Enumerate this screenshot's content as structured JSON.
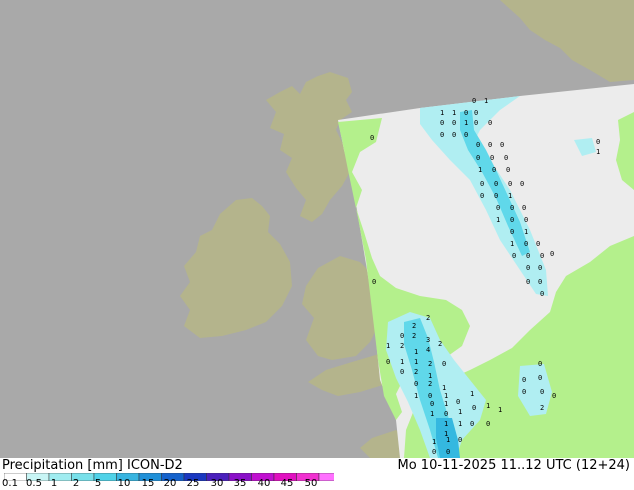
{
  "header": {
    "title": "Precipitation [mm]  ICON-D2",
    "valid": "Mo 10-11-2025 11..12 UTC (12+24)"
  },
  "legend": {
    "ticks": [
      "0.1",
      "0.5",
      "1",
      "2",
      "5",
      "10",
      "15",
      "20",
      "25",
      "30",
      "35",
      "40",
      "45",
      "50"
    ],
    "colors": [
      "#ffffff",
      "#c8f5f5",
      "#a0ecf0",
      "#78e0ea",
      "#50d2e8",
      "#38b4e0",
      "#2090d8",
      "#1462cc",
      "#1a38c0",
      "#4a20bc",
      "#8a10c8",
      "#c010d0",
      "#e010c0",
      "#f030d0",
      "#ff70ff"
    ]
  },
  "map": {
    "colors": {
      "sea_outside": "#a9a9a9",
      "land_outside": "#b4b48c",
      "domain_sea": "#ececec",
      "domain_land": "#b4f08c",
      "precip_light": "#b0eef2",
      "precip_mid": "#60d8ea",
      "precip_heavy": "#34b8e0"
    },
    "values": [
      {
        "v": "0"
      },
      {
        "v": "1"
      },
      {
        "v": "1"
      },
      {
        "v": "1"
      },
      {
        "v": "0"
      },
      {
        "v": "0"
      },
      {
        "v": "0"
      },
      {
        "v": "0"
      },
      {
        "v": "1"
      },
      {
        "v": "0"
      },
      {
        "v": "0"
      },
      {
        "v": "0"
      },
      {
        "v": "0"
      },
      {
        "v": "0"
      },
      {
        "v": "0"
      },
      {
        "v": "0"
      },
      {
        "v": "0"
      },
      {
        "v": "0"
      },
      {
        "v": "0"
      },
      {
        "v": "0"
      },
      {
        "v": "1"
      },
      {
        "v": "0"
      },
      {
        "v": "0"
      },
      {
        "v": "0"
      },
      {
        "v": "0"
      },
      {
        "v": "0"
      },
      {
        "v": "0"
      },
      {
        "v": "0"
      },
      {
        "v": "0"
      },
      {
        "v": "1"
      },
      {
        "v": "0"
      },
      {
        "v": "0"
      },
      {
        "v": "0"
      },
      {
        "v": "1"
      },
      {
        "v": "0"
      },
      {
        "v": "0"
      },
      {
        "v": "0"
      },
      {
        "v": "1"
      },
      {
        "v": "1"
      },
      {
        "v": "0"
      },
      {
        "v": "0"
      },
      {
        "v": "0"
      },
      {
        "v": "0"
      },
      {
        "v": "0"
      },
      {
        "v": "0"
      },
      {
        "v": "0"
      },
      {
        "v": "0"
      },
      {
        "v": "0"
      },
      {
        "v": "0"
      },
      {
        "v": "0"
      },
      {
        "v": "0"
      },
      {
        "v": "0"
      },
      {
        "v": "2"
      },
      {
        "v": "2"
      },
      {
        "v": "0"
      },
      {
        "v": "2"
      },
      {
        "v": "3"
      },
      {
        "v": "1"
      },
      {
        "v": "2"
      },
      {
        "v": "1"
      },
      {
        "v": "4"
      },
      {
        "v": "2"
      },
      {
        "v": "0"
      },
      {
        "v": "1"
      },
      {
        "v": "1"
      },
      {
        "v": "2"
      },
      {
        "v": "0"
      },
      {
        "v": "0"
      },
      {
        "v": "2"
      },
      {
        "v": "1"
      },
      {
        "v": "0"
      },
      {
        "v": "2"
      },
      {
        "v": "1"
      },
      {
        "v": "1"
      },
      {
        "v": "0"
      },
      {
        "v": "1"
      },
      {
        "v": "0"
      },
      {
        "v": "1"
      },
      {
        "v": "0"
      },
      {
        "v": "1"
      },
      {
        "v": "1"
      },
      {
        "v": "0"
      },
      {
        "v": "1"
      },
      {
        "v": "0"
      },
      {
        "v": "1"
      },
      {
        "v": "1"
      },
      {
        "v": "1"
      },
      {
        "v": "1"
      },
      {
        "v": "1"
      },
      {
        "v": "0"
      },
      {
        "v": "0"
      },
      {
        "v": "0"
      },
      {
        "v": "0"
      },
      {
        "v": "0"
      },
      {
        "v": "0"
      },
      {
        "v": "0"
      },
      {
        "v": "0"
      },
      {
        "v": "2"
      },
      {
        "v": "1"
      },
      {
        "v": "1"
      },
      {
        "v": "0"
      },
      {
        "v": "0"
      },
      {
        "v": "0"
      },
      {
        "v": "0"
      },
      {
        "v": "1"
      },
      {
        "v": "0"
      },
      {
        "v": "0"
      }
    ]
  }
}
